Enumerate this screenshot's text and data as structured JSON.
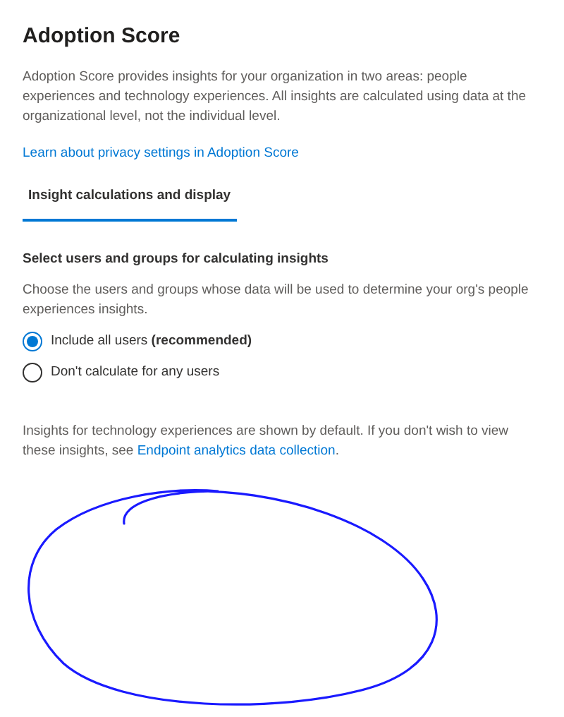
{
  "title": "Adoption Score",
  "intro": "Adoption Score provides insights for your organization in two areas: people experiences and technology experiences. All insights are calculated using data at the organizational level, not the individual level.",
  "privacy_link": "Learn about privacy settings in Adoption Score",
  "tabs": [
    {
      "label": "Insight calculations and display",
      "selected": true
    }
  ],
  "section": {
    "heading": "Select users and groups for calculating insights",
    "description": "Choose the users and groups whose data will be used to determine your org's people experiences insights."
  },
  "options": [
    {
      "label": "Include all users **(recommended)**",
      "selected": true
    },
    {
      "label": "Don't calculate for any users",
      "selected": false
    }
  ],
  "footer": {
    "text": "Insights for technology experiences are shown by default. If you don't wish to view these insights, see ",
    "link": "Endpoint analytics data collection",
    "after": "."
  }
}
